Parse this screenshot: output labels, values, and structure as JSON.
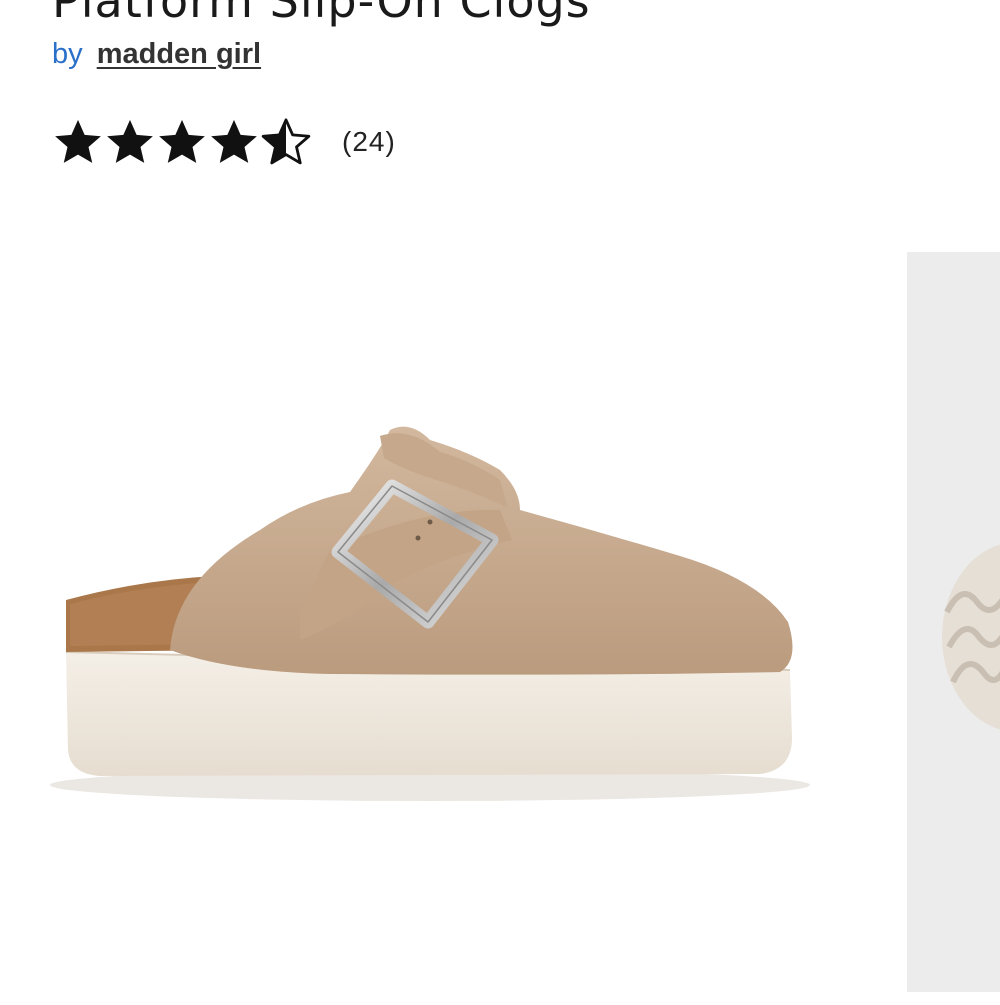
{
  "product": {
    "title": "Platform Slip-On Clogs",
    "by_label": "by",
    "brand": "madden girl",
    "rating": {
      "value": 4.5,
      "max": 5,
      "review_count_text": "(24)"
    }
  },
  "colors": {
    "by_link": "#2a70c8",
    "star": "#111111",
    "suede": "#c9ad92",
    "sole": "#efe9df",
    "cork": "#a9774a",
    "thumbnail_bg": "#ececec"
  },
  "gallery": {
    "main_image_icon": "shoe-image",
    "next_image_icon": "shoe-sole-thumbnail"
  }
}
